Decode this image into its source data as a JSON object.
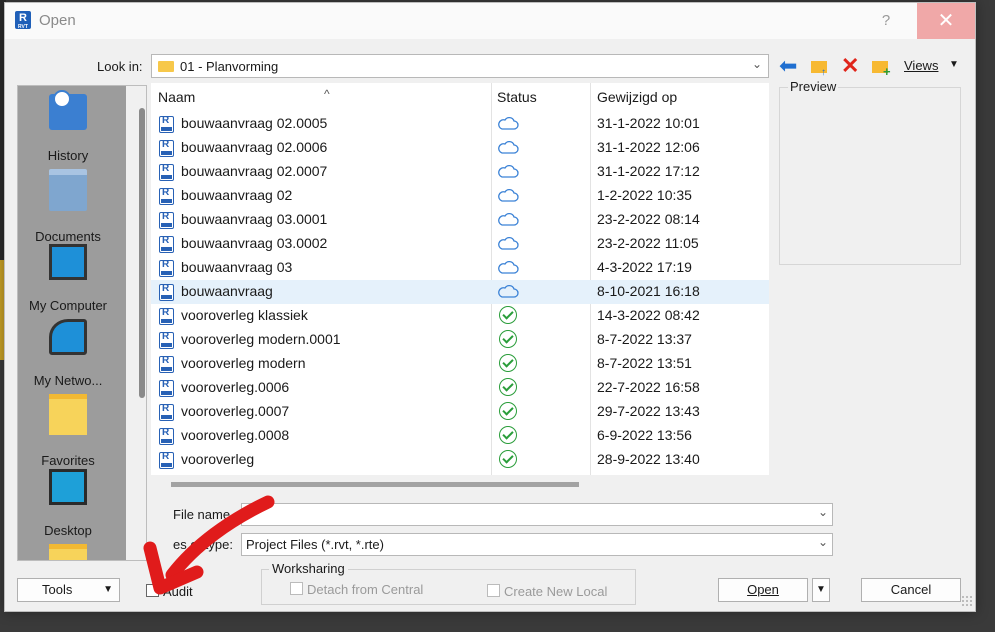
{
  "window": {
    "title": "Open",
    "help": "?",
    "close": "✕",
    "app_icon": "R",
    "app_icon_sub": "RVT"
  },
  "lookin": {
    "label": "Look in:",
    "value": "01 - Planvorming"
  },
  "toolbar": {
    "views_label": "Views"
  },
  "places": [
    "History",
    "Documents",
    "My Computer",
    "My Netwo...",
    "Favorites",
    "Desktop"
  ],
  "columns": {
    "name": "Naam",
    "status": "Status",
    "date": "Gewijzigd op"
  },
  "files": [
    {
      "name": "bouwaanvraag 02.0005",
      "status": "cloud",
      "date": "31-1-2022 10:01"
    },
    {
      "name": "bouwaanvraag 02.0006",
      "status": "cloud",
      "date": "31-1-2022 12:06"
    },
    {
      "name": "bouwaanvraag 02.0007",
      "status": "cloud",
      "date": "31-1-2022 17:12"
    },
    {
      "name": "bouwaanvraag 02",
      "status": "cloud",
      "date": "1-2-2022 10:35"
    },
    {
      "name": "bouwaanvraag 03.0001",
      "status": "cloud",
      "date": "23-2-2022 08:14"
    },
    {
      "name": "bouwaanvraag 03.0002",
      "status": "cloud",
      "date": "23-2-2022 11:05"
    },
    {
      "name": "bouwaanvraag 03",
      "status": "cloud",
      "date": "4-3-2022 17:19"
    },
    {
      "name": "bouwaanvraag",
      "status": "cloud",
      "date": "8-10-2021 16:18",
      "selected": true
    },
    {
      "name": "vooroverleg klassiek",
      "status": "synced",
      "date": "14-3-2022 08:42"
    },
    {
      "name": "vooroverleg modern.0001",
      "status": "synced",
      "date": "8-7-2022 13:37"
    },
    {
      "name": "vooroverleg modern",
      "status": "synced",
      "date": "8-7-2022 13:51"
    },
    {
      "name": "vooroverleg.0006",
      "status": "synced",
      "date": "22-7-2022 16:58"
    },
    {
      "name": "vooroverleg.0007",
      "status": "synced",
      "date": "29-7-2022 13:43"
    },
    {
      "name": "vooroverleg.0008",
      "status": "synced",
      "date": "6-9-2022 13:56"
    },
    {
      "name": "vooroverleg",
      "status": "synced",
      "date": "28-9-2022 13:40"
    }
  ],
  "preview": {
    "label": "Preview"
  },
  "filename": {
    "label": "File name",
    "value": ""
  },
  "filetype": {
    "label": "es of type:",
    "value": "Project Files  (*.rvt, *.rte)"
  },
  "bottom": {
    "tools": "Tools",
    "audit": "Audit",
    "worksharing": "Worksharing",
    "detach": "Detach from Central",
    "create_local": "Create New Local",
    "open": "Open",
    "cancel": "Cancel"
  },
  "colors": {
    "selected_row": "#e5f1fb",
    "cloud": "#3b82d6",
    "synced": "#2a9d3a",
    "annotation_arrow": "#e01b1b",
    "close_button": "#f0a8a8"
  },
  "icons": {
    "back": "back-arrow-icon",
    "up": "up-folder-icon",
    "delete": "delete-icon",
    "new_folder": "new-folder-icon"
  }
}
